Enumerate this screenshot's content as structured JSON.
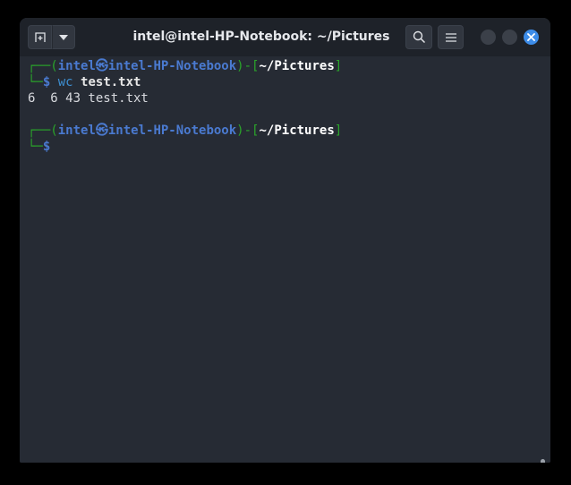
{
  "window": {
    "title": "intel@intel-HP-Notebook: ~/Pictures"
  },
  "toolbar": {
    "new_tab_icon": "new-tab-icon",
    "dropdown_icon": "chevron-down-icon",
    "search_icon": "search-icon",
    "menu_icon": "hamburger-icon",
    "close_icon": "close-icon"
  },
  "prompt": {
    "open_corner": "┌──(",
    "user": "intel",
    "at_symbol": "㉿",
    "host": "intel-HP-Notebook",
    "close_paren": ")",
    "sep": "-",
    "bracket_open": "[",
    "cwd": "~/Pictures",
    "bracket_close": "]",
    "second_corner": "└─",
    "dollar": "$"
  },
  "session": {
    "command": "wc",
    "command_arg": "test.txt",
    "output": "6  6 43 test.txt"
  },
  "colors": {
    "prompt_frame": "#2aa52a",
    "prompt_user": "#4a7ad0",
    "close_button": "#3d8ce8",
    "background": "#262b34"
  }
}
